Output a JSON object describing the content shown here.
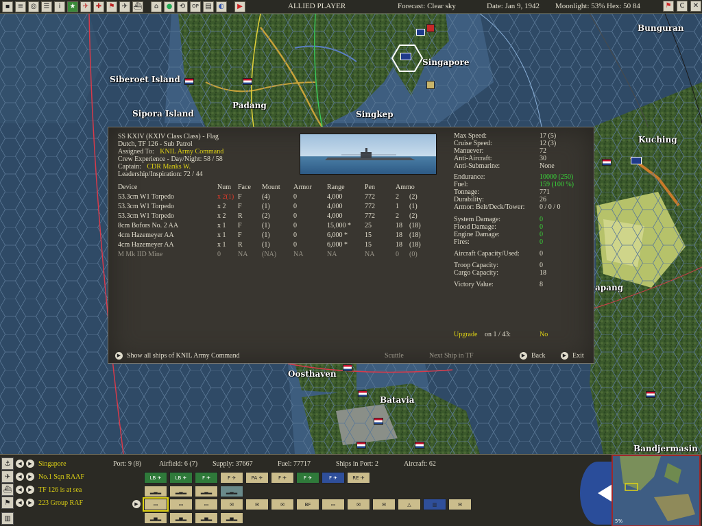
{
  "topbar": {
    "side": "ALLIED PLAYER",
    "forecast": "Forecast: Clear sky",
    "date": "Date: Jan 9, 1942",
    "moonlight": "Moonlight: 53%",
    "hex": "Hex: 50 84",
    "buttons": [
      "menu",
      "report",
      "target",
      "list",
      "info",
      "star",
      "aircraft",
      "tf",
      "flag",
      "airfield",
      "ship",
      "road",
      "ground",
      "globe",
      "cycle",
      "ops",
      "chart",
      "mirror",
      "end-turn"
    ],
    "right_buttons": [
      "flag-toggle",
      "C",
      "X"
    ]
  },
  "map": {
    "places": [
      {
        "name": "Bunguran"
      },
      {
        "name": "Singapore"
      },
      {
        "name": "Siberoet Island"
      },
      {
        "name": "Padang"
      },
      {
        "name": "Singkep"
      },
      {
        "name": "Sipora Island"
      },
      {
        "name": "Kuching"
      },
      {
        "name": "apang"
      },
      {
        "name": "Oosthaven"
      },
      {
        "name": "Batavia"
      },
      {
        "name": "Bandjermasin"
      }
    ]
  },
  "dialog": {
    "ship_title": "SS KXIV (KXIV Class Class) - Flag",
    "tf_line": "Dutch, TF 126 - Sub Patrol",
    "assigned_label": "Assigned To:",
    "assigned_value": "KNIL Army Command",
    "crew_exp": "Crew Experience - Day/Night: 58 / 58",
    "captain_label": "Captain:",
    "captain_value": "CDR Manks W.",
    "leadership": "Leadership/Inspiration: 72 / 44",
    "columns": [
      "Device",
      "Num",
      "Face",
      "Mount",
      "Armor",
      "Range",
      "Pen",
      "Ammo"
    ],
    "devices": [
      {
        "device": "53.3cm W1 Torpedo",
        "num": "x 2(1)",
        "face": "F",
        "mount": "(4)",
        "armor": "0",
        "range": "4,000",
        "pen": "772",
        "ammo": "2",
        "ammo2": "(2)",
        "num_red": true,
        "dim": false
      },
      {
        "device": "53.3cm W1 Torpedo",
        "num": "x 2",
        "face": "F",
        "mount": "(1)",
        "armor": "0",
        "range": "4,000",
        "pen": "772",
        "ammo": "1",
        "ammo2": "(1)",
        "num_red": false,
        "dim": false
      },
      {
        "device": "53.3cm W1 Torpedo",
        "num": "x 2",
        "face": "R",
        "mount": "(2)",
        "armor": "0",
        "range": "4,000",
        "pen": "772",
        "ammo": "2",
        "ammo2": "(2)",
        "num_red": false,
        "dim": false
      },
      {
        "device": "8cm Bofors No. 2 AA",
        "num": "x 1",
        "face": "F",
        "mount": "(1)",
        "armor": "0",
        "range": "15,000 *",
        "pen": "25",
        "ammo": "18",
        "ammo2": "(18)",
        "num_red": false,
        "dim": false
      },
      {
        "device": "4cm Hazemeyer AA",
        "num": "x 1",
        "face": "F",
        "mount": "(1)",
        "armor": "0",
        "range": "6,000 *",
        "pen": "15",
        "ammo": "18",
        "ammo2": "(18)",
        "num_red": false,
        "dim": false
      },
      {
        "device": "4cm Hazemeyer AA",
        "num": "x 1",
        "face": "R",
        "mount": "(1)",
        "armor": "0",
        "range": "6,000 *",
        "pen": "15",
        "ammo": "18",
        "ammo2": "(18)",
        "num_red": false,
        "dim": false
      },
      {
        "device": "M Mk IID Mine",
        "num": "0",
        "face": "NA",
        "mount": "(NA)",
        "armor": "NA",
        "range": "NA",
        "pen": "NA",
        "ammo": "0",
        "ammo2": "(0)",
        "num_red": false,
        "dim": true
      }
    ],
    "stats": [
      {
        "label": "Max Speed:",
        "value": "17 (5)",
        "color": "normal"
      },
      {
        "label": "Cruise Speed:",
        "value": "12 (3)",
        "color": "normal"
      },
      {
        "label": "Manuever:",
        "value": "72",
        "color": "normal"
      },
      {
        "label": "Anti-Aircraft:",
        "value": "30",
        "color": "normal"
      },
      {
        "label": "Anti-Submarine:",
        "value": "None",
        "color": "normal"
      }
    ],
    "stats2": [
      {
        "label": "Endurance:",
        "value": "10000 (250)",
        "color": "green"
      },
      {
        "label": "Fuel:",
        "value": "159 (100 %)",
        "color": "green"
      },
      {
        "label": "Tonnage:",
        "value": "771",
        "color": "normal"
      },
      {
        "label": "Durability:",
        "value": "26",
        "color": "normal"
      },
      {
        "label": "Armor: Belt/Deck/Tower:",
        "value": "0 / 0 / 0",
        "color": "normal"
      }
    ],
    "stats3": [
      {
        "label": "System Damage:",
        "value": "0",
        "color": "green"
      },
      {
        "label": "Flood Damage:",
        "value": "0",
        "color": "green"
      },
      {
        "label": "Engine Damage:",
        "value": "0",
        "color": "green"
      },
      {
        "label": "Fires:",
        "value": "0",
        "color": "green"
      }
    ],
    "aircraft_cap_label": "Aircraft Capacity/Used:",
    "aircraft_cap_value": "0",
    "troop_label": "Troop Capacity:",
    "troop_value": "0",
    "cargo_label": "Cargo Capacity:",
    "cargo_value": "18",
    "victory_label": "Victory Value:",
    "victory_value": "8",
    "upgrade_label": "Upgrade",
    "upgrade_on": "on 1 / 43:",
    "upgrade_value": "No",
    "show_all": "Show all ships of KNIL Army Command",
    "scuttle": "Scuttle",
    "next_ship": "Next Ship in TF",
    "back": "Back",
    "exit": "Exit"
  },
  "bottom": {
    "rows": [
      {
        "name": "Singapore",
        "icon": "base-icon"
      },
      {
        "name": "No.1 Sqn RAAF",
        "icon": "air-unit-icon"
      },
      {
        "name": "TF 126 is at sea",
        "icon": "ship-icon"
      },
      {
        "name": "223 Group RAF",
        "icon": "flag-icon"
      }
    ],
    "port": "Port: 9 (8)",
    "airfield": "Airfield: 6 (7)",
    "supply": "Supply: 37667",
    "fuel": "Fuel: 77717",
    "ships_in_port": "Ships in Port: 2",
    "aircraft": "Aircraft: 62",
    "air_units": [
      "LB",
      "LB",
      "F",
      "F",
      "PA",
      "F",
      "F",
      "F",
      "RE"
    ],
    "minimap_zoom": "5%"
  }
}
